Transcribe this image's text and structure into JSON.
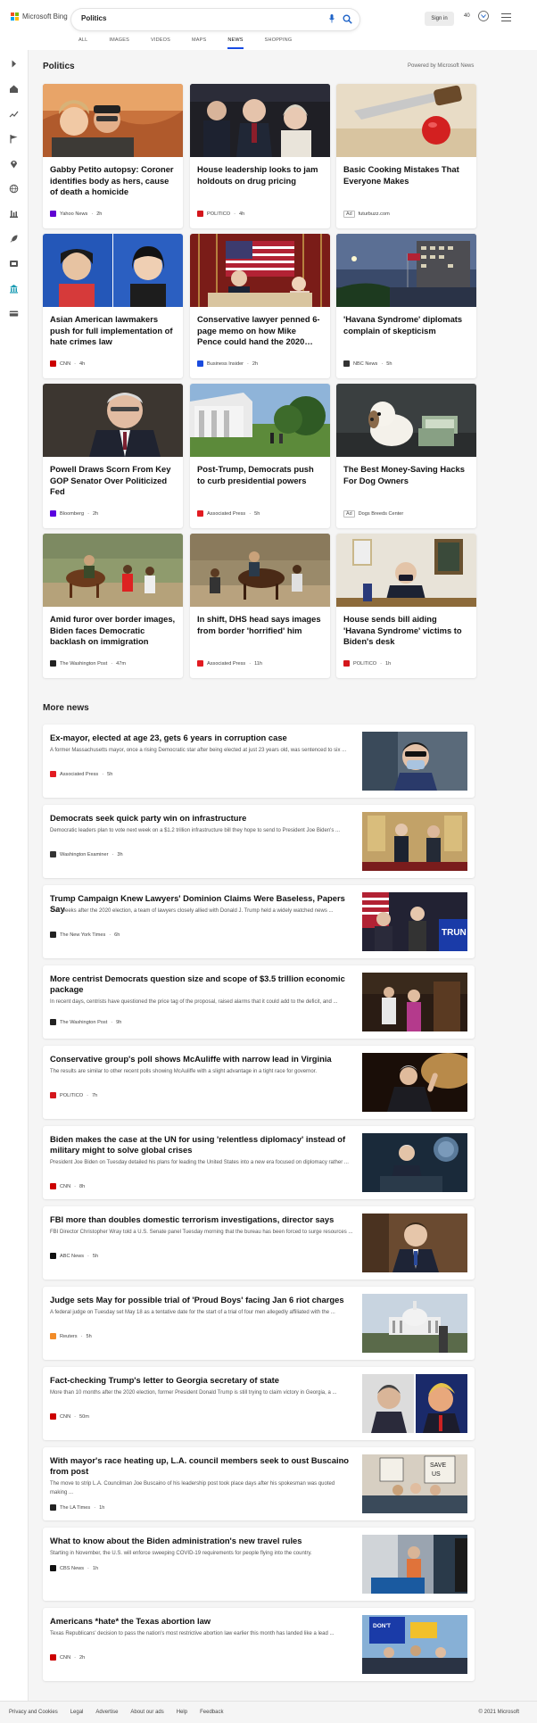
{
  "header": {
    "logo_text": "Microsoft Bing",
    "query": "Politics",
    "signin_label": "Sign in",
    "rewards_count": "40",
    "tabs": [
      "ALL",
      "IMAGES",
      "VIDEOS",
      "MAPS",
      "NEWS",
      "SHOPPING"
    ],
    "active_tab": "NEWS"
  },
  "sidebar": {
    "icons": [
      "expand-icon",
      "home-icon",
      "trending-icon",
      "flag-icon",
      "location-icon",
      "globe-icon",
      "balance-icon",
      "rocket-icon",
      "entertainment-icon",
      "building-icon",
      "money-icon"
    ]
  },
  "top": {
    "title": "Politics",
    "powered_by": "Powered by Microsoft News",
    "cards": [
      {
        "title": "Gabby Petito autopsy: Coroner identifies body as hers, cause of death a homicide",
        "source": "Yahoo News",
        "time": "2h",
        "ad": false,
        "logo_color": "#6001d2"
      },
      {
        "title": "House leadership looks to jam holdouts on drug pricing",
        "source": "POLITICO",
        "time": "4h",
        "ad": false,
        "logo_color": "#d4161c"
      },
      {
        "title": "Basic Cooking Mistakes That Everyone Makes",
        "source": "futurbuzz.com",
        "time": "",
        "ad": true,
        "ad_label": "Ad",
        "logo_color": ""
      },
      {
        "title": "Asian American lawmakers push for full implementation of hate crimes law",
        "source": "CNN",
        "time": "4h",
        "ad": false,
        "logo_color": "#cc0000"
      },
      {
        "title": "Conservative lawyer penned 6-page memo on how Mike Pence could hand the 2020…",
        "source": "Business Insider",
        "time": "2h",
        "ad": false,
        "logo_color": "#1a4bde"
      },
      {
        "title": "'Havana Syndrome' diplomats complain of skepticism",
        "source": "NBC News",
        "time": "5h",
        "ad": false,
        "logo_color": "#333333"
      },
      {
        "title": "Powell Draws Scorn From Key GOP Senator Over Politicized Fed",
        "source": "Bloomberg",
        "time": "2h",
        "ad": false,
        "logo_color": "#5a00e0"
      },
      {
        "title": "Post-Trump, Democrats push to curb presidential powers",
        "source": "Associated Press",
        "time": "5h",
        "ad": false,
        "logo_color": "#e21b22"
      },
      {
        "title": "The Best Money-Saving Hacks For Dog Owners",
        "source": "Dogs Breeds Center",
        "time": "",
        "ad": true,
        "ad_label": "Ad",
        "logo_color": ""
      },
      {
        "title": "Amid furor over border images, Biden faces Democratic backlash on immigration",
        "source": "The Washington Post",
        "time": "47m",
        "ad": false,
        "logo_color": "#222222"
      },
      {
        "title": "In shift, DHS head says images from border 'horrified' him",
        "source": "Associated Press",
        "time": "11h",
        "ad": false,
        "logo_color": "#e21b22"
      },
      {
        "title": "House sends bill aiding 'Havana Syndrome' victims to Biden's desk",
        "source": "POLITICO",
        "time": "1h",
        "ad": false,
        "logo_color": "#d4161c"
      }
    ]
  },
  "more": {
    "title": "More news",
    "items": [
      {
        "title": "Ex-mayor, elected at age 23, gets 6 years in corruption case",
        "snippet": "A former Massachusetts mayor, once a rising Democratic star after being elected at just 23 years old, was sentenced to six ...",
        "source": "Associated Press",
        "time": "5h",
        "logo_color": "#e21b22"
      },
      {
        "title": "Democrats seek quick party win on infrastructure",
        "snippet": "Democratic leaders plan to vote next week on a $1.2 trillion infrastructure bill they hope to send to President Joe Biden's ...",
        "source": "Washington Examiner",
        "time": "3h",
        "logo_color": "#333333"
      },
      {
        "title": "Trump Campaign Knew Lawyers' Dominion Claims Were Baseless, Papers Say",
        "snippet": "Two weeks after the 2020 election, a team of lawyers closely allied with Donald J. Trump held a widely watched news ...",
        "source": "The New York Times",
        "time": "6h",
        "logo_color": "#222222"
      },
      {
        "title": "More centrist Democrats question size and scope of $3.5 trillion economic package",
        "snippet": "In recent days, centrists have questioned the price tag of the proposal, raised alarms that it could add to the deficit, and ...",
        "source": "The Washington Post",
        "time": "9h",
        "logo_color": "#222222"
      },
      {
        "title": "Conservative group's poll shows McAuliffe with narrow lead in Virginia",
        "snippet": "The results are similar to other recent polls showing McAuliffe with a slight advantage in a tight race for governor.",
        "source": "POLITICO",
        "time": "7h",
        "logo_color": "#d4161c"
      },
      {
        "title": "Biden makes the case at the UN for using 'relentless diplomacy' instead of military might to solve global crises",
        "snippet": "President Joe Biden on Tuesday detailed his plans for leading the United States into a new era focused on diplomacy rather ...",
        "source": "CNN",
        "time": "8h",
        "logo_color": "#cc0000"
      },
      {
        "title": "FBI more than doubles domestic terrorism investigations, director says",
        "snippet": "FBI Director Christopher Wray told a U.S. Senate panel Tuesday morning that the bureau has been forced to surge resources ...",
        "source": "ABC News",
        "time": "5h",
        "logo_color": "#111111"
      },
      {
        "title": "Judge sets May for possible trial of 'Proud Boys' facing Jan 6 riot charges",
        "snippet": "A federal judge on Tuesday set May 18 as a tentative date for the start of a trial of four men allegedly affiliated with the ...",
        "source": "Reuters",
        "time": "5h",
        "logo_color": "#f28c28"
      },
      {
        "title": "Fact-checking Trump's letter to Georgia secretary of state",
        "snippet": "More than 10 months after the 2020 election, former President Donald Trump is still trying to claim victory in Georgia, a ...",
        "source": "CNN",
        "time": "50m",
        "logo_color": "#cc0000"
      },
      {
        "title": "With mayor's race heating up, L.A. council members seek to oust Buscaino from post",
        "snippet": "The move to strip L.A. Councilman Joe Buscaino of his leadership post took place days after his spokesman was quoted making ...",
        "source": "The LA Times",
        "time": "1h",
        "logo_color": "#222222"
      },
      {
        "title": "What to know about the Biden administration's new travel rules",
        "snippet": "Starting in November, the U.S. will enforce sweeping COVID-19 requirements for people flying into the country.",
        "source": "CBS News",
        "time": "1h",
        "logo_color": "#111111"
      },
      {
        "title": "Americans *hate* the Texas abortion law",
        "snippet": "Texas Republicans' decision to pass the nation's most restrictive abortion law earlier this month has landed like a lead ...",
        "source": "CNN",
        "time": "2h",
        "logo_color": "#cc0000"
      }
    ]
  },
  "footer": {
    "links": [
      "Privacy and Cookies",
      "Legal",
      "Advertise",
      "About our ads",
      "Help",
      "Feedback"
    ],
    "copyright": "© 2021 Microsoft"
  }
}
